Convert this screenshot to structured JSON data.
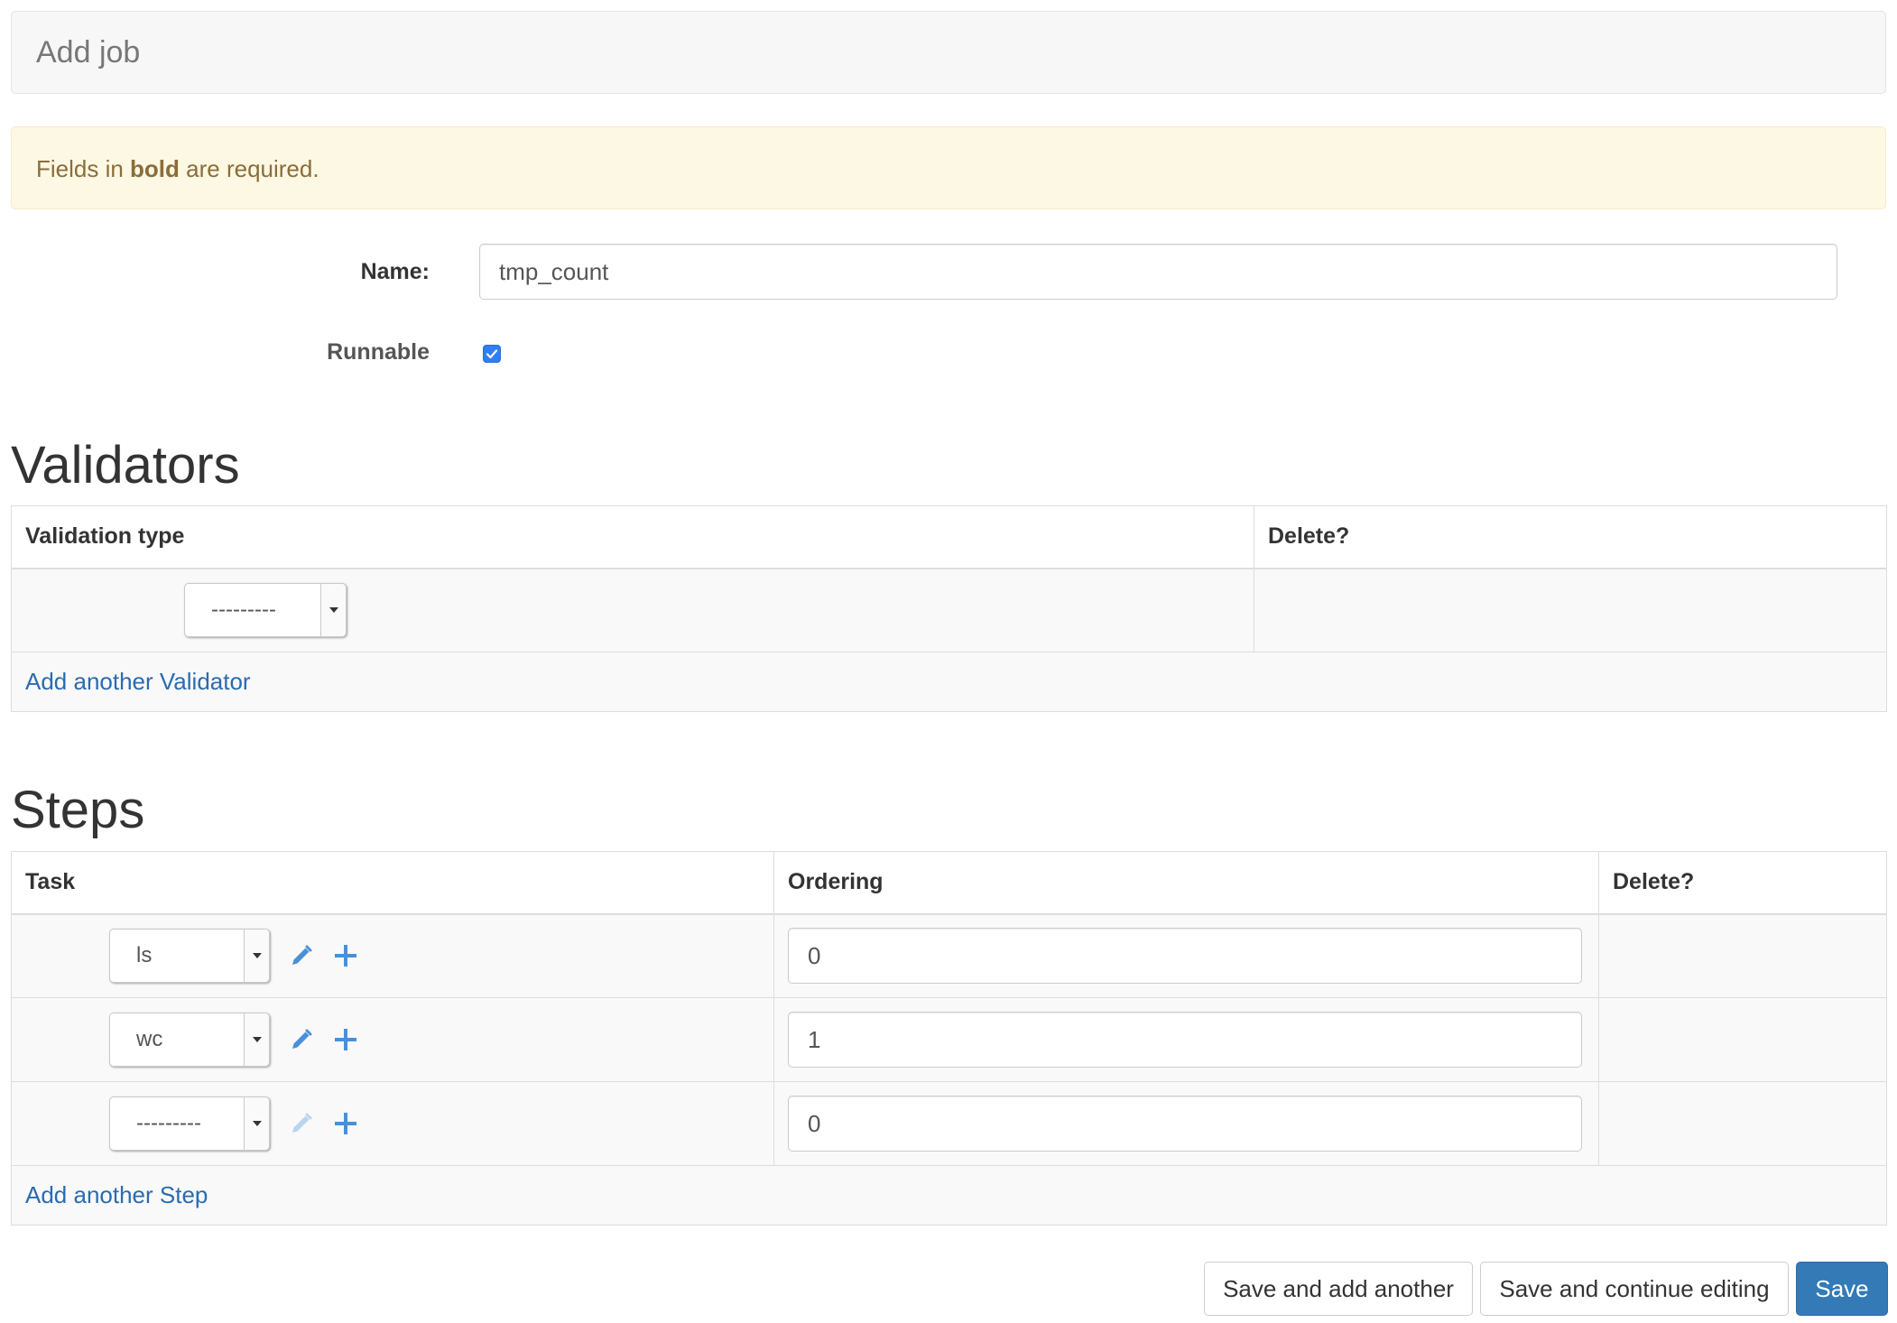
{
  "header": {
    "title": "Add job"
  },
  "alert": {
    "prefix": "Fields in ",
    "bold": "bold",
    "suffix": " are required."
  },
  "form": {
    "name_label": "Name:",
    "name_value": "tmp_count",
    "runnable_label": "Runnable",
    "runnable_checked": true
  },
  "validators": {
    "title": "Validators",
    "columns": [
      "Validation type",
      "Delete?"
    ],
    "rows": [
      {
        "type": "---------"
      }
    ],
    "add_link": "Add another Validator"
  },
  "steps": {
    "title": "Steps",
    "columns": [
      "Task",
      "Ordering",
      "Delete?"
    ],
    "rows": [
      {
        "task": "ls",
        "ordering": "0",
        "edit_enabled": true
      },
      {
        "task": "wc",
        "ordering": "1",
        "edit_enabled": true
      },
      {
        "task": "---------",
        "ordering": "0",
        "edit_enabled": false
      }
    ],
    "add_link": "Add another Step"
  },
  "actions": {
    "save_add_another": "Save and add another",
    "save_continue": "Save and continue editing",
    "save": "Save"
  },
  "colors": {
    "primary": "#337ab7",
    "link": "#2a6bb0",
    "alert_bg": "#fcf8e3",
    "alert_text": "#8a6d3b",
    "checkbox": "#2f7ff0"
  },
  "icons": {
    "edit": "pencil-icon",
    "add": "plus-icon",
    "checkbox": "check-icon"
  }
}
